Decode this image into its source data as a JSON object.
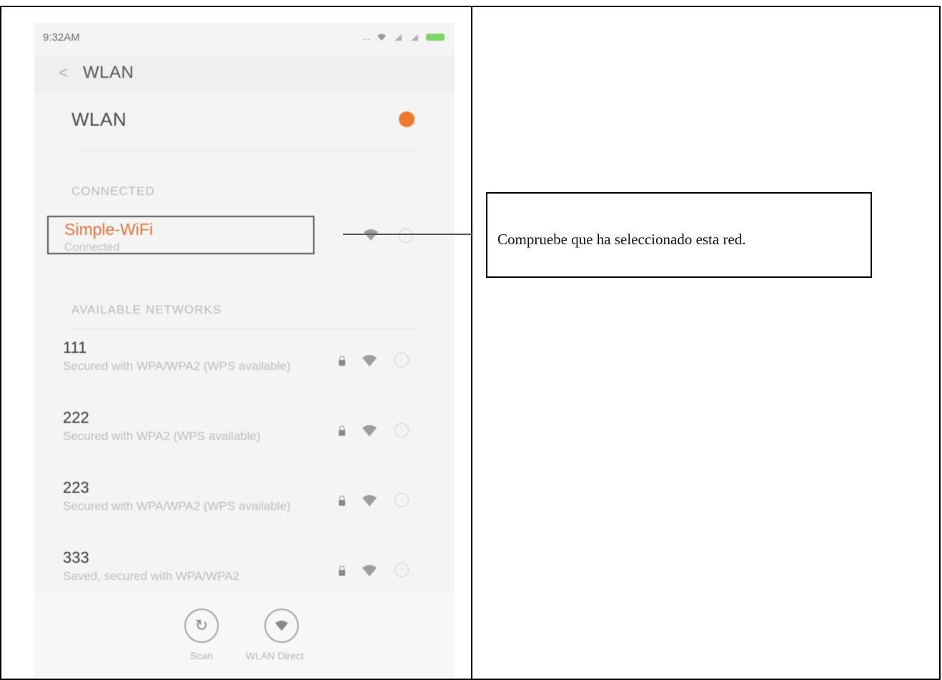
{
  "status_bar": {
    "time": "9:32AM",
    "signal_dots": "..."
  },
  "app_bar": {
    "back_glyph": "<",
    "title": "WLAN"
  },
  "wlan_toggle": {
    "label": "WLAN",
    "state": "on",
    "accent_color": "#ee7a2e"
  },
  "connected_section": {
    "header": "CONNECTED",
    "network": {
      "name": "Simple-WiFi",
      "status": "Connected"
    }
  },
  "available_section": {
    "header": "AVAILABLE NETWORKS",
    "networks": [
      {
        "name": "111",
        "description": "Secured with WPA/WPA2 (WPS available)"
      },
      {
        "name": "222",
        "description": "Secured with WPA2 (WPS available)"
      },
      {
        "name": "223",
        "description": "Secured with WPA/WPA2 (WPS available)"
      },
      {
        "name": "333",
        "description": "Saved, secured with WPA/WPA2"
      }
    ]
  },
  "bottom_bar": {
    "scan_label": "Scan",
    "direct_label": "WLAN Direct"
  },
  "annotation": {
    "text": "Compruebe que ha seleccionado esta red."
  },
  "icons": [
    "back-icon",
    "wifi-icon",
    "lock-icon",
    "chevron-right-icon",
    "battery-icon",
    "scan-icon",
    "wlan-direct-icon"
  ]
}
